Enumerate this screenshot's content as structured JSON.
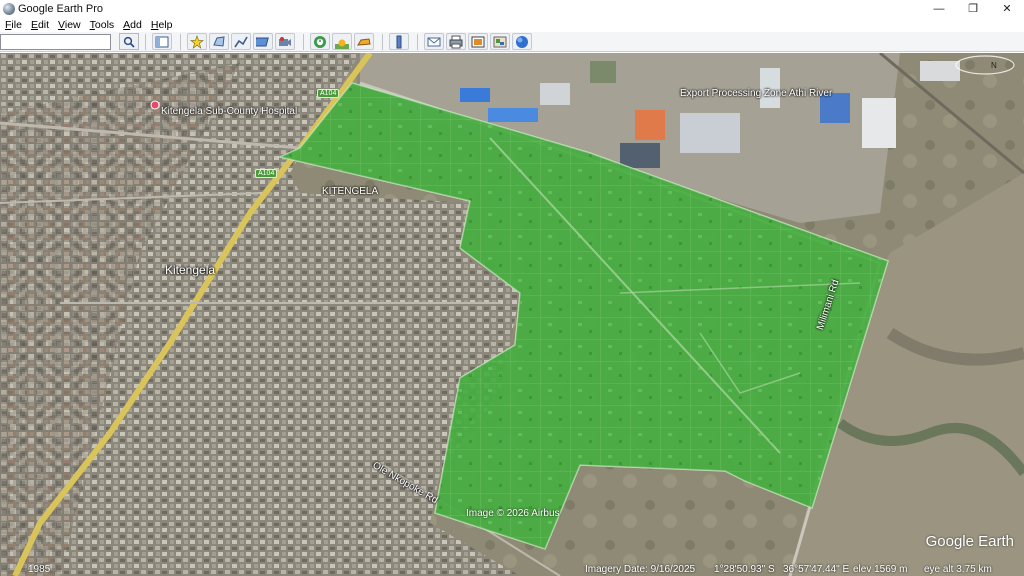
{
  "window": {
    "title": "Google Earth Pro",
    "minimize": "—",
    "restore": "❐",
    "close": "✕"
  },
  "menu": {
    "file": "F",
    "file_rest": "ile",
    "edit": "E",
    "edit_rest": "dit",
    "view": "V",
    "view_rest": "iew",
    "tools": "T",
    "tools_rest": "ools",
    "add": "A",
    "add_rest": "dd",
    "help": "H",
    "help_rest": "elp"
  },
  "search": {
    "value": "",
    "placeholder": ""
  },
  "toolbar_icons": [
    "sidebar-icon",
    "placemark-icon",
    "polygon-icon",
    "path-icon",
    "image-overlay-icon",
    "record-tour-icon",
    "historical-imagery-icon",
    "sunlight-icon",
    "planets-icon",
    "ruler-icon",
    "email-icon",
    "print-icon",
    "save-image-icon",
    "view-in-maps-icon",
    "earth-icon"
  ],
  "map": {
    "labels": {
      "hospital": "Kitengela Sub-County Hospital",
      "kitengela_upper": "KITENGELA",
      "kitengela": "Kitengela",
      "epz": "Export Processing Zone Athi River",
      "road_right": "Milimani Rd",
      "road_bottom": "Ole Nkopoke Rd",
      "shield_1": "A104",
      "shield_2": "A104"
    },
    "compass_letter": "N",
    "attribution": "Image © 2026 Airbus",
    "logo": "Google Earth",
    "overlay_color": "#2fa52a"
  },
  "status": {
    "year": "1985",
    "imagery_date": "Imagery Date: 9/16/2025",
    "lat": "1°28'50.93\" S",
    "lon": "36°57'47.44\" E",
    "elev": "elev  1569 m",
    "eye_alt": "eye alt  3.75 km"
  }
}
